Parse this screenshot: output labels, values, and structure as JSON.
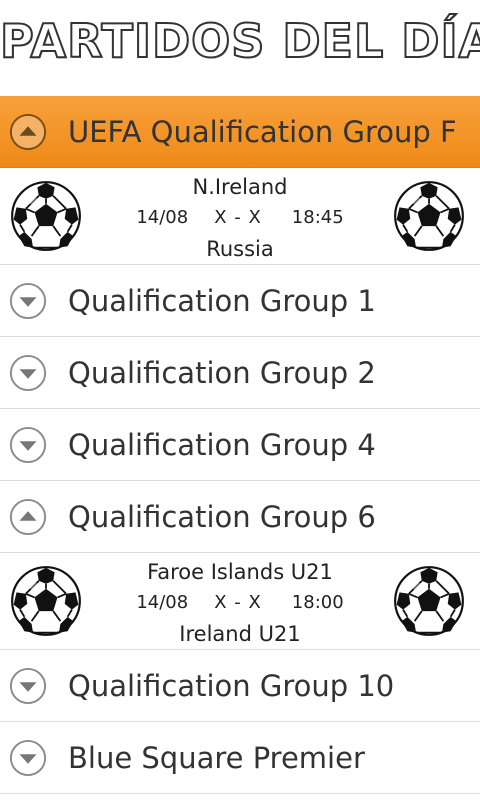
{
  "header": {
    "title": "PARTIDOS DEL DÍA"
  },
  "groups": [
    {
      "label": "UEFA Qualification Group F",
      "expanded": true,
      "match": {
        "home": "N.Ireland",
        "date": "14/08",
        "score": "X - X",
        "time": "18:45",
        "away": "Russia"
      }
    },
    {
      "label": "Qualification Group 1",
      "expanded": false
    },
    {
      "label": "Qualification Group 2",
      "expanded": false
    },
    {
      "label": "Qualification Group 4",
      "expanded": false
    },
    {
      "label": "Qualification Group 6",
      "expanded": true,
      "match": {
        "home": "Faroe Islands U21",
        "date": "14/08",
        "score": "X - X",
        "time": "18:00",
        "away": "Ireland U21"
      }
    },
    {
      "label": "Qualification Group 10",
      "expanded": false
    },
    {
      "label": "Blue Square Premier",
      "expanded": false
    }
  ],
  "colors": {
    "active_header": "#f39422",
    "text": "#333333",
    "divider": "#dddddd"
  },
  "icons": {
    "expand": "chevron-down-circle-icon",
    "collapse": "chevron-up-circle-icon",
    "team_badge": "soccer-ball-icon"
  }
}
